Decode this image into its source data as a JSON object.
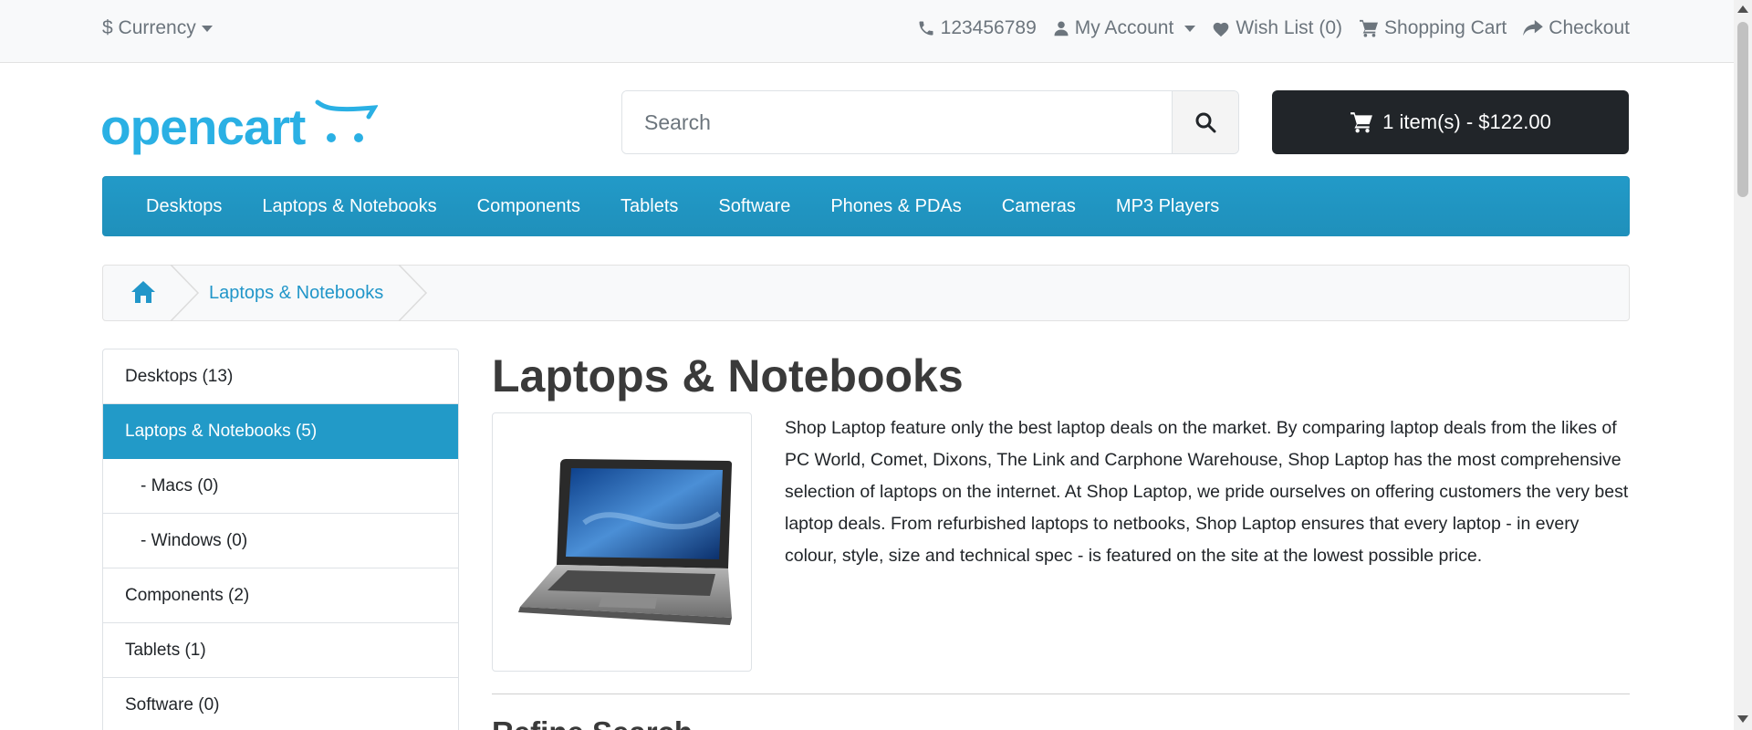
{
  "topbar": {
    "currency_symbol": "$",
    "currency_label": "Currency",
    "phone": "123456789",
    "account": "My Account",
    "wishlist": "Wish List (0)",
    "cart": "Shopping Cart",
    "checkout": "Checkout"
  },
  "header": {
    "logo_text": "opencart",
    "search_placeholder": "Search",
    "cart_button": "1 item(s) - $122.00"
  },
  "menu": [
    "Desktops",
    "Laptops & Notebooks",
    "Components",
    "Tablets",
    "Software",
    "Phones & PDAs",
    "Cameras",
    "MP3 Players"
  ],
  "breadcrumb": {
    "current": "Laptops & Notebooks"
  },
  "sidebar": [
    {
      "label": "Desktops (13)",
      "active": false,
      "sub": false
    },
    {
      "label": "Laptops & Notebooks (5)",
      "active": true,
      "sub": false
    },
    {
      "label": "- Macs (0)",
      "active": false,
      "sub": true
    },
    {
      "label": "- Windows (0)",
      "active": false,
      "sub": true
    },
    {
      "label": "Components (2)",
      "active": false,
      "sub": false
    },
    {
      "label": "Tablets (1)",
      "active": false,
      "sub": false
    },
    {
      "label": "Software (0)",
      "active": false,
      "sub": false
    }
  ],
  "content": {
    "title": "Laptops & Notebooks",
    "description": "Shop Laptop feature only the best laptop deals on the market. By comparing laptop deals from the likes of PC World, Comet, Dixons, The Link and Carphone Warehouse, Shop Laptop has the most comprehensive selection of laptops on the internet. At Shop Laptop, we pride ourselves on offering customers the very best laptop deals. From refurbished laptops to netbooks, Shop Laptop ensures that every laptop - in every colour, style, size and technical spec - is featured on the site at the lowest possible price.",
    "refine_heading": "Refine Search"
  },
  "colors": {
    "accent": "#229ac8",
    "dark": "#212529",
    "link": "#2196c9"
  }
}
